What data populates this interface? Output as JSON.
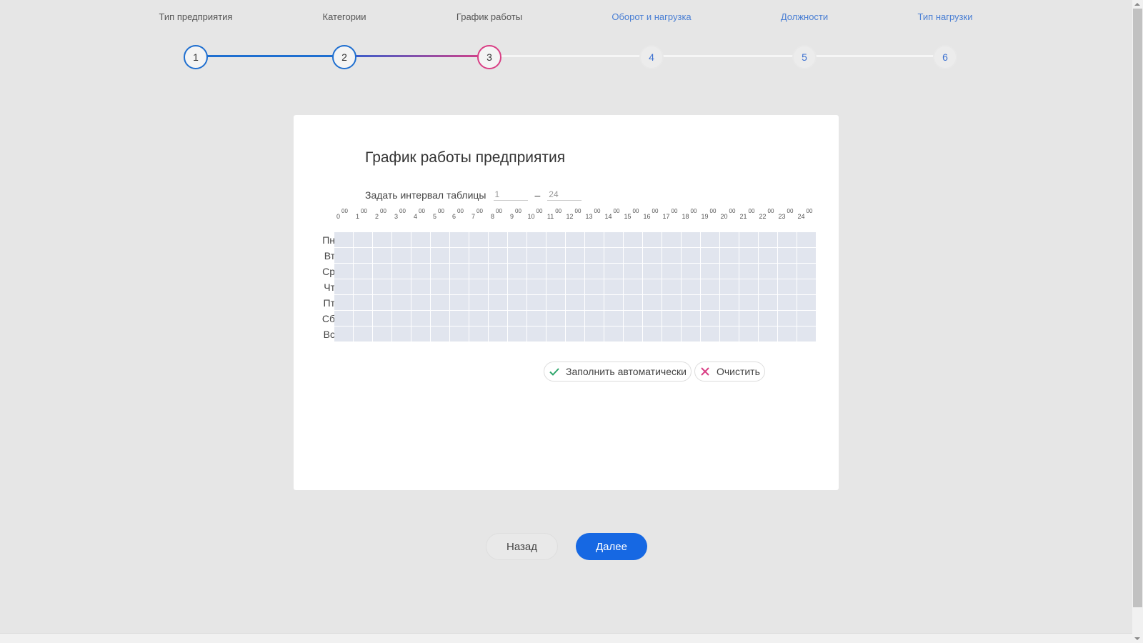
{
  "stepper": {
    "steps": [
      {
        "number": "1",
        "label": "Тип предприятия",
        "state": "done"
      },
      {
        "number": "2",
        "label": "Категории",
        "state": "done"
      },
      {
        "number": "3",
        "label": "График работы",
        "state": "current"
      },
      {
        "number": "4",
        "label": "Оборот и нагрузка",
        "state": "future"
      },
      {
        "number": "5",
        "label": "Должности",
        "state": "future"
      },
      {
        "number": "6",
        "label": "Тип нагрузки",
        "state": "future"
      }
    ],
    "colors": {
      "done": "#1f6fd0",
      "current": "#d93f85",
      "future": "#f4f4f4"
    }
  },
  "card": {
    "title": "График работы предприятия",
    "interval": {
      "label": "Задать интервал таблицы",
      "from_value": "1",
      "dash": "–",
      "to_value": "24"
    },
    "hours": [
      "0",
      "1",
      "2",
      "3",
      "4",
      "5",
      "6",
      "7",
      "8",
      "9",
      "10",
      "11",
      "12",
      "13",
      "14",
      "15",
      "16",
      "17",
      "18",
      "19",
      "20",
      "21",
      "22",
      "23",
      "24"
    ],
    "minutes_suffix": "00",
    "days": [
      "Пн",
      "Вт",
      "Ср",
      "Чт",
      "Пт",
      "Сб",
      "Вс"
    ],
    "actions": {
      "autofill_label": "Заполнить автоматически",
      "clear_label": "Очистить"
    }
  },
  "nav": {
    "back_label": "Назад",
    "next_label": "Далее"
  },
  "colors": {
    "accent": "#1668e3",
    "cell": "#e1e5ee",
    "check": "#2ca56a",
    "clear": "#d93f85"
  }
}
